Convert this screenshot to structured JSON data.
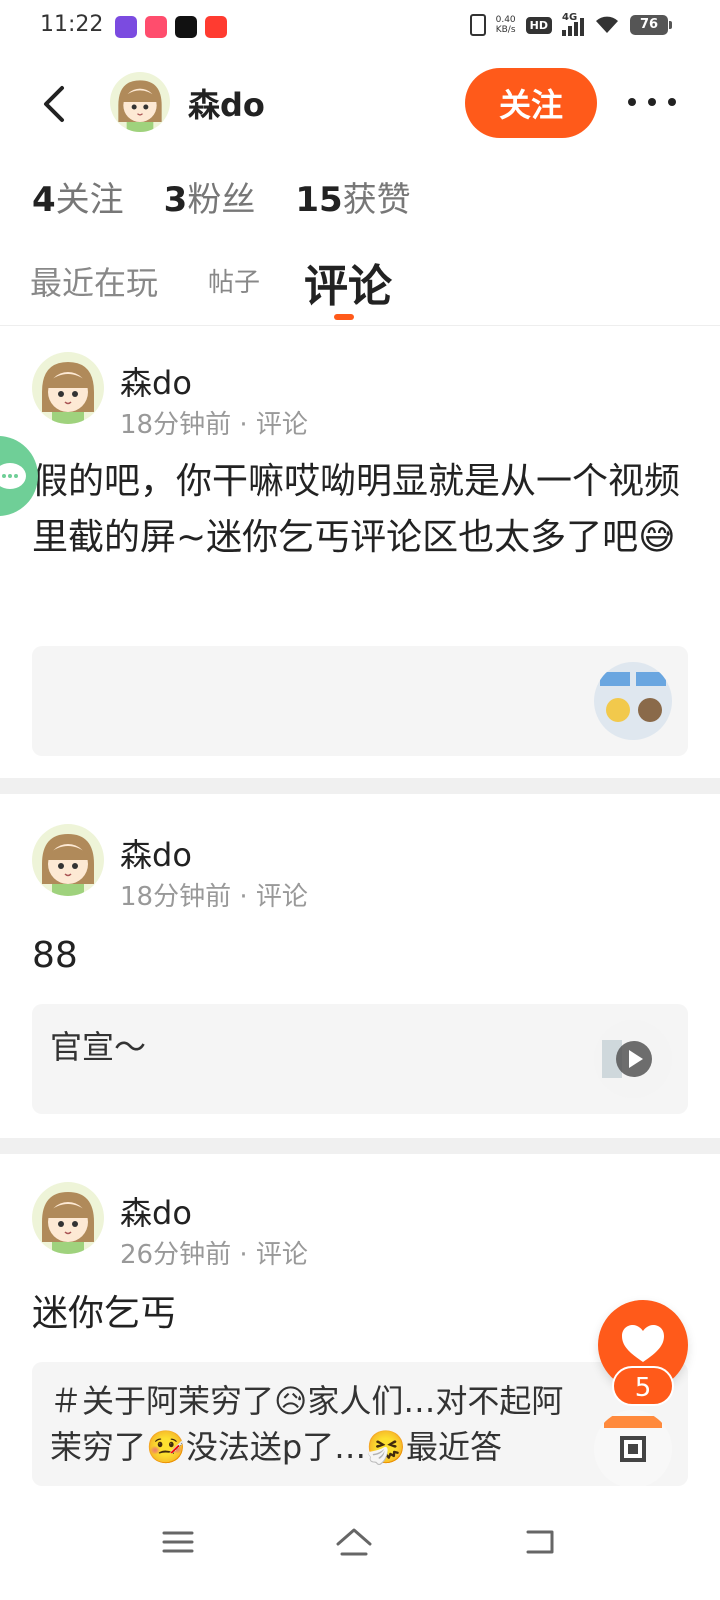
{
  "status_bar": {
    "time": "11:22",
    "net_speed_value": "0.40",
    "net_speed_unit": "KB/s",
    "hd_label": "HD",
    "network_label": "4G",
    "battery": "76"
  },
  "header": {
    "username": "森do",
    "follow_label": "关注"
  },
  "stats": [
    {
      "value": "4",
      "label": "关注"
    },
    {
      "value": "3",
      "label": "粉丝"
    },
    {
      "value": "15",
      "label": "获赞"
    }
  ],
  "tabs": {
    "recent": "最近在玩",
    "posts": "帖子",
    "comments": "评论"
  },
  "posts": [
    {
      "author": "森do",
      "meta": "18分钟前 · 评论",
      "text": "假的吧，你干嘛哎呦明显就是从一个视频里截的屏~迷你乞丐评论区也太多了吧😅",
      "quote": ""
    },
    {
      "author": "森do",
      "meta": "18分钟前 · 评论",
      "text": "88",
      "quote": "官宣～"
    },
    {
      "author": "森do",
      "meta": "26分钟前 · 评论",
      "text": "迷你乞丐",
      "quote": "＃关于阿茉穷了😥家人们…对不起阿茉穷了🤒没法送p了…🤧最近答"
    }
  ],
  "like_count": "5",
  "colors": {
    "accent": "#ff5a1a",
    "chat_float": "#6fcf97"
  }
}
